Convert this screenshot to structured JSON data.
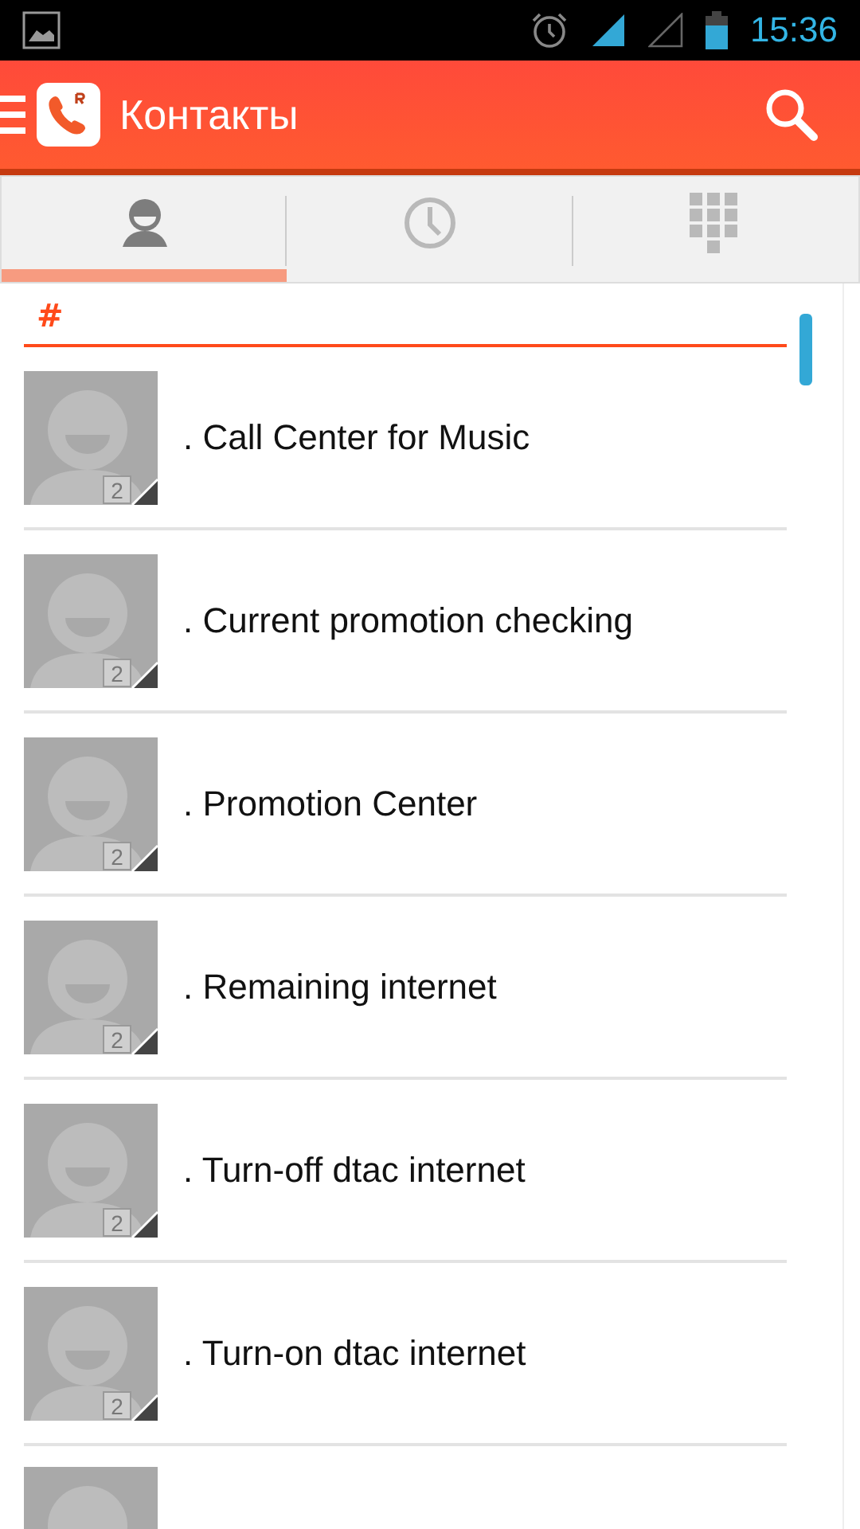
{
  "status_bar": {
    "time": "15:36"
  },
  "app_bar": {
    "title": "Контакты"
  },
  "tabs": [
    {
      "kind": "contacts",
      "selected": true
    },
    {
      "kind": "recent",
      "selected": false
    },
    {
      "kind": "dialpad",
      "selected": false
    }
  ],
  "section": {
    "header": "#"
  },
  "contacts": [
    {
      "name": ". Call Center for Music",
      "sim": "2"
    },
    {
      "name": ". Current promotion checking",
      "sim": "2"
    },
    {
      "name": ". Promotion Center",
      "sim": "2"
    },
    {
      "name": ". Remaining internet",
      "sim": "2"
    },
    {
      "name": ". Turn-off dtac internet",
      "sim": "2"
    },
    {
      "name": ". Turn-on dtac internet",
      "sim": "2"
    }
  ],
  "more_below": true
}
